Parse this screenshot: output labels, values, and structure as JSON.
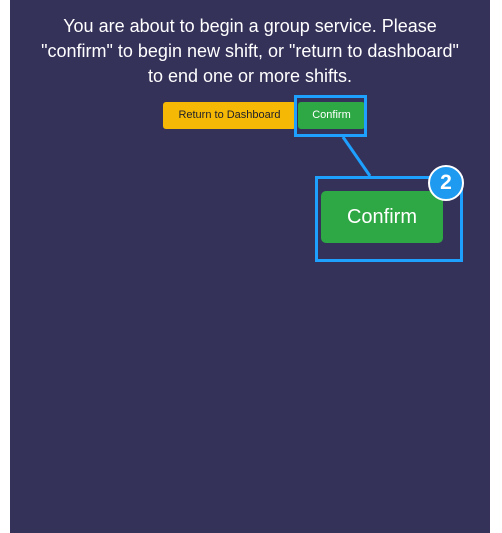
{
  "message": {
    "line1": "You are about to begin a group service. Please",
    "line2": "\"confirm\" to begin new shift, or \"return to dashboard\"",
    "line3": "to end one or more shifts."
  },
  "buttons": {
    "return_label": "Return to Dashboard",
    "confirm_label": "Confirm"
  },
  "callout": {
    "step_number": "2",
    "zoom_label": "Confirm"
  },
  "colors": {
    "background": "#35325a",
    "return_button": "#f5b905",
    "confirm_button": "#2ea844",
    "highlight": "#1ea0ff"
  }
}
